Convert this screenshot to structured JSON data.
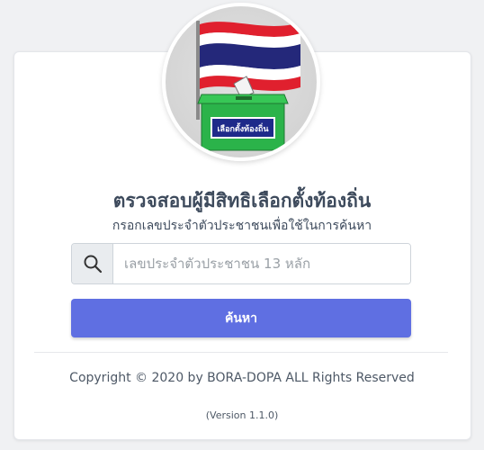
{
  "header": {
    "title": "ตรวจสอบผู้มีสิทธิเลือกตั้งท้องถิ่น",
    "subtitle": "กรอกเลขประจำตัวประชาชนเพื่อใช้ในการค้นหา"
  },
  "logo": {
    "box_label": "เลือกตั้งท้องถิ่น",
    "colors": {
      "flag_red": "#e0202e",
      "flag_white": "#ffffff",
      "flag_blue": "#24287a",
      "box_green": "#2bb34a"
    }
  },
  "search": {
    "placeholder": "เลขประจำตัวประชาชน 13 หลัก",
    "value": "",
    "icon": "search-icon",
    "button_label": "ค้นหา",
    "button_color": "#5f6fe2"
  },
  "footer": {
    "copyright": "Copyright © 2020 by BORA-DOPA ALL Rights Reserved",
    "version": "(Version 1.1.0)"
  }
}
